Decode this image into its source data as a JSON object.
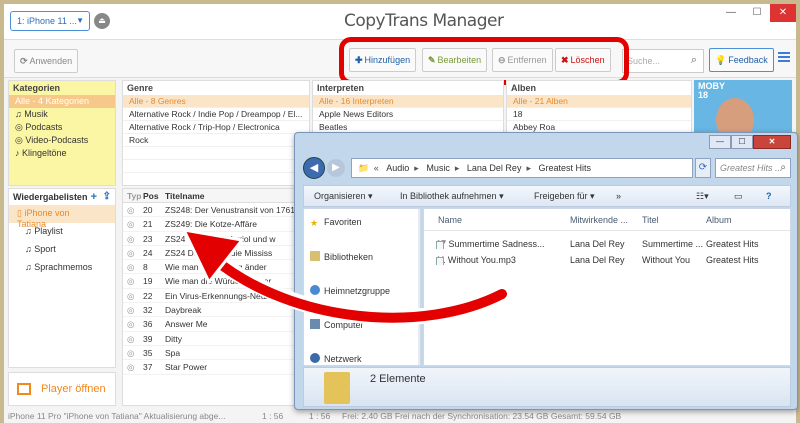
{
  "topbar": {
    "device": "1: iPhone 11 ...",
    "app_title": "CopyTrans Manager",
    "win_minimize": "—",
    "win_maximize": "☐",
    "win_close": "✕"
  },
  "toolbar": {
    "apply": "Anwenden",
    "add": "Hinzufügen",
    "edit": "Bearbeiten",
    "remove": "Entfernen",
    "delete": "Löschen",
    "search_placeholder": "Suche...",
    "feedback": "Feedback",
    "highlight_color": "#e20000"
  },
  "categories": {
    "title": "Kategorien",
    "items": [
      "Alle - 4 Kategorien",
      "Musik",
      "Podcasts",
      "Video-Podcasts",
      "Klingeltöne"
    ]
  },
  "genre": {
    "title": "Genre",
    "items": [
      "Alle - 8 Genres",
      "Alternative Rock / Indie Pop / Dreampop / El...",
      "Alternative Rock / Trip-Hop / Electronica",
      "Rock",
      "",
      "",
      ""
    ]
  },
  "artist": {
    "title": "Interpreten",
    "items": [
      "Alle - 16 Interpreten",
      "Apple News Editors",
      "Beatles"
    ]
  },
  "album": {
    "title": "Alben",
    "items": [
      "Alle - 21 Alben",
      "18",
      "Abbey Roa"
    ]
  },
  "album_art": {
    "text": "MOBY\n18"
  },
  "playlists": {
    "title": "Wiedergabelisten",
    "items": [
      "iPhone von Tatiana",
      "Playlist",
      "Sport",
      "Sprachmemos"
    ],
    "player_button": "Player öffnen"
  },
  "tracks": {
    "headers": [
      "Typ",
      "Pos",
      "Titelname"
    ],
    "rows": [
      {
        "pos": "20",
        "title": "ZS248: Der Venustransit von 1761"
      },
      {
        "pos": "21",
        "title": "ZS249: Die Kotze-Affäre"
      },
      {
        "pos": "23",
        "title": "ZS24 Mühle von Auriol und w"
      },
      {
        "pos": "24",
        "title": "ZS24 Dahlia und die Mississ"
      },
      {
        "pos": "8",
        "title": "Wie man ... Umgang änder"
      },
      {
        "pos": "19",
        "title": "Wie man die Würde ... uerer"
      },
      {
        "pos": "22",
        "title": "Ein Virus-Erkennungs-Netzwerk, ..."
      },
      {
        "pos": "32",
        "title": "Daybreak"
      },
      {
        "pos": "36",
        "title": "Answer Me"
      },
      {
        "pos": "39",
        "title": "Ditty"
      },
      {
        "pos": "35",
        "title": "Spa"
      },
      {
        "pos": "37",
        "title": "Star Power"
      }
    ]
  },
  "statusbar": {
    "left": "iPhone 11 Pro \"iPhone von Tatiana\" Aktualisierung abge...",
    "time": "1 : 56",
    "time2": "1 : 56",
    "right": "Frei: 2.40 GB Frei nach der Synchronisation: 23.54 GB Gesamt: 59.54 GB"
  },
  "explorer": {
    "breadcrumbs": [
      "Audio",
      "Music",
      "Lana Del Rey",
      "Greatest Hits"
    ],
    "search_placeholder": "Greatest Hits ...",
    "commands": [
      "Organisieren ▾",
      "In Bibliothek aufnehmen ▾",
      "Freigeben für ▾",
      "»"
    ],
    "nav_items": [
      "Favoriten",
      "Bibliotheken",
      "Heimnetzgruppe",
      "Computer",
      "Netzwerk"
    ],
    "columns": [
      "Name",
      "Mitwirkende ...",
      "Titel",
      "Album"
    ],
    "files": [
      {
        "name": "07 Summertime Sadness...",
        "artist": "Lana Del Rey",
        "title": "Summertime ...",
        "album": "Greatest Hits"
      },
      {
        "name": "11 Without You.mp3",
        "artist": "Lana Del Rey",
        "title": "Without You",
        "album": "Greatest Hits"
      }
    ],
    "details": "2 Elemente"
  }
}
